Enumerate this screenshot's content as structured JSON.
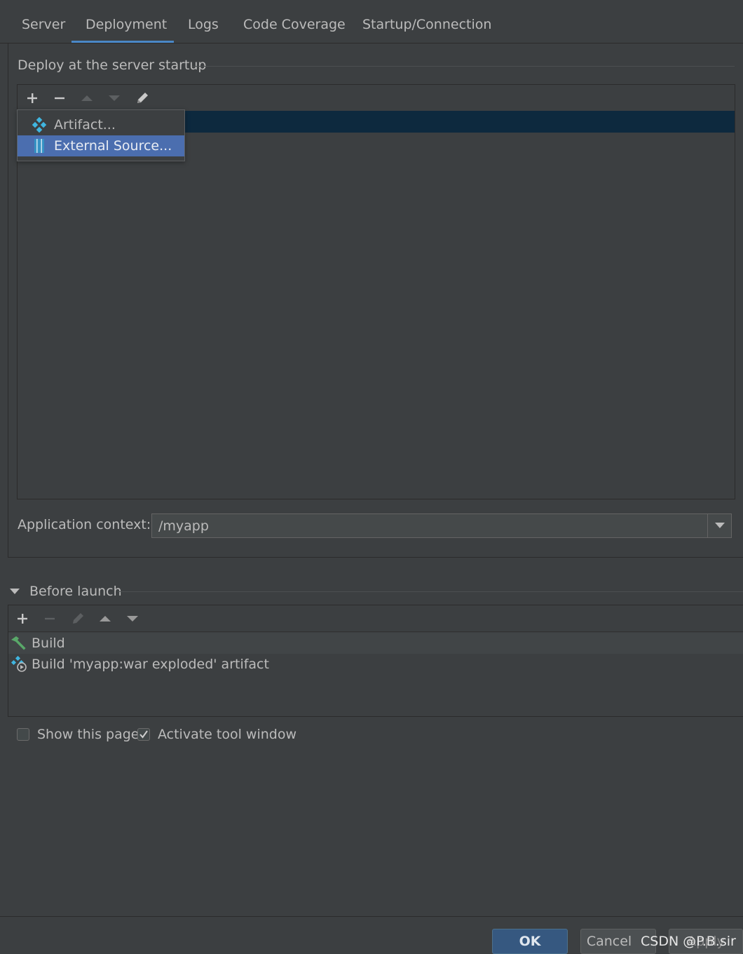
{
  "tabs": [
    {
      "label": "Server"
    },
    {
      "label": "Deployment",
      "selected": true
    },
    {
      "label": "Logs"
    },
    {
      "label": "Code Coverage"
    },
    {
      "label": "Startup/Connection"
    }
  ],
  "deployment": {
    "section_title": "Deploy at the server startup",
    "toolbar": [
      "add-icon",
      "remove-icon",
      "move-up-icon",
      "move-down-icon",
      "edit-icon"
    ],
    "add_menu": {
      "items": [
        {
          "label": "Artifact...",
          "icon": "artifact-icon"
        },
        {
          "label": "External Source...",
          "icon": "external-source-icon",
          "highlighted": true
        }
      ]
    },
    "app_context_label": "Application context:",
    "app_context_value": "/myapp"
  },
  "before_launch": {
    "title": "Before launch",
    "toolbar": [
      "add-icon",
      "remove-icon",
      "edit-icon",
      "move-up-icon",
      "move-down-icon"
    ],
    "tasks": [
      {
        "label": "Build",
        "icon": "build-hammer-icon"
      },
      {
        "label": "Build 'myapp:war exploded' artifact",
        "icon": "build-artifact-icon"
      }
    ]
  },
  "options": {
    "show_page_label": "Show this page",
    "show_page_checked": false,
    "activate_tool_window_label": "Activate tool window",
    "activate_tool_window_checked": true
  },
  "footer": {
    "ok_label": "OK",
    "cancel_label": "Cancel",
    "apply_label": "Apply"
  },
  "watermark": "CSDN @P.B.sir",
  "colors": {
    "background": "#3c3f41",
    "selection": "#0d293e",
    "menu_highlight": "#4b6eaf",
    "tab_underline": "#4a88c7",
    "ok_button": "#365880"
  }
}
